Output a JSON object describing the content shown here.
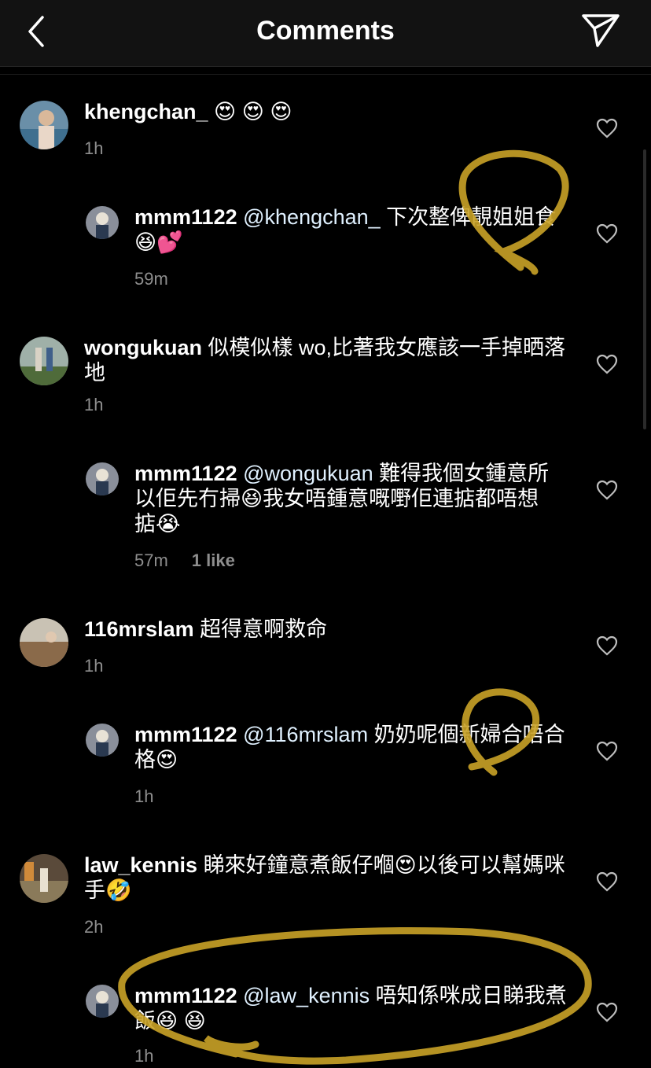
{
  "header": {
    "title": "Comments"
  },
  "comments": [
    {
      "user": "khengchan_",
      "text": " 😍 😍 😍",
      "mention": "",
      "time": "1h",
      "likes": "",
      "reply": {
        "user": "mmm1122",
        "mention": "@khengchan_",
        "text": " 下次整俾靚姐姐食😆💕",
        "time": "59m",
        "likes": ""
      }
    },
    {
      "user": "wongukuan",
      "text": " 似模似樣 wo,比著我女應該一手掉晒落地",
      "mention": "",
      "time": "1h",
      "likes": "",
      "reply": {
        "user": "mmm1122",
        "mention": "@wongukuan",
        "text": " 難得我個女鍾意所以佢先冇掃😆我女唔鍾意嘅嘢佢連掂都唔想掂😭",
        "time": "57m",
        "likes": "1 like"
      }
    },
    {
      "user": "116mrslam",
      "text": " 超得意啊救命",
      "mention": "",
      "time": "1h",
      "likes": "",
      "reply": {
        "user": "mmm1122",
        "mention": "@116mrslam",
        "text": " 奶奶呢個新婦合唔合格😍",
        "time": "1h",
        "likes": ""
      }
    },
    {
      "user": "law_kennis",
      "text": " 睇來好鐘意煮飯仔嗰😍以後可以幫媽咪手🤣",
      "mention": "",
      "time": "2h",
      "likes": "",
      "reply": {
        "user": "mmm1122",
        "mention": "@law_kennis",
        "text": " 唔知係咪成日睇我煮飯😆 😆",
        "time": "1h",
        "likes": ""
      }
    }
  ],
  "icons": {
    "back": "chevron-left-icon",
    "send": "paper-plane-icon",
    "like": "heart-icon"
  },
  "colors": {
    "background": "#000000",
    "header": "#121212",
    "meta": "#8e8e8e",
    "annotation": "#c9a227"
  }
}
